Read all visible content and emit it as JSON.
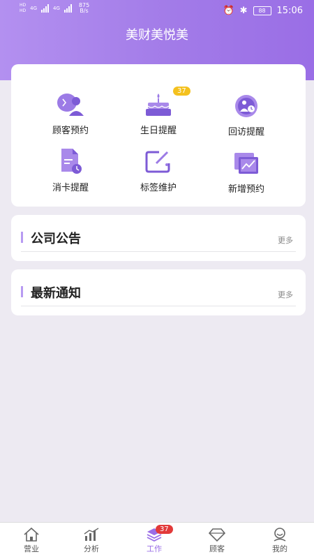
{
  "status_bar": {
    "sim1": "HD",
    "sim2": "HD",
    "net1": "4G",
    "net2": "4G",
    "speed_value": "875",
    "speed_unit": "B/s",
    "battery": "88",
    "time": "15:06"
  },
  "header": {
    "title": "美财美悦美"
  },
  "features": [
    {
      "label": "顾客预约"
    },
    {
      "label": "生日提醒",
      "badge": "37"
    },
    {
      "label": "回访提醒"
    },
    {
      "label": "消卡提醒"
    },
    {
      "label": "标签维护"
    },
    {
      "label": "新增预约"
    }
  ],
  "sections": {
    "announcements": {
      "title": "公司公告",
      "more": "更多"
    },
    "notices": {
      "title": "最新通知",
      "more": "更多"
    }
  },
  "tabbar": {
    "items": [
      {
        "label": "营业"
      },
      {
        "label": "分析"
      },
      {
        "label": "工作",
        "badge": "37",
        "active": true
      },
      {
        "label": "顾客"
      },
      {
        "label": "我的"
      }
    ]
  },
  "colors": {
    "accent": "#9a6ee6",
    "badge_yellow": "#f4c11e",
    "badge_red": "#e23a3a"
  }
}
